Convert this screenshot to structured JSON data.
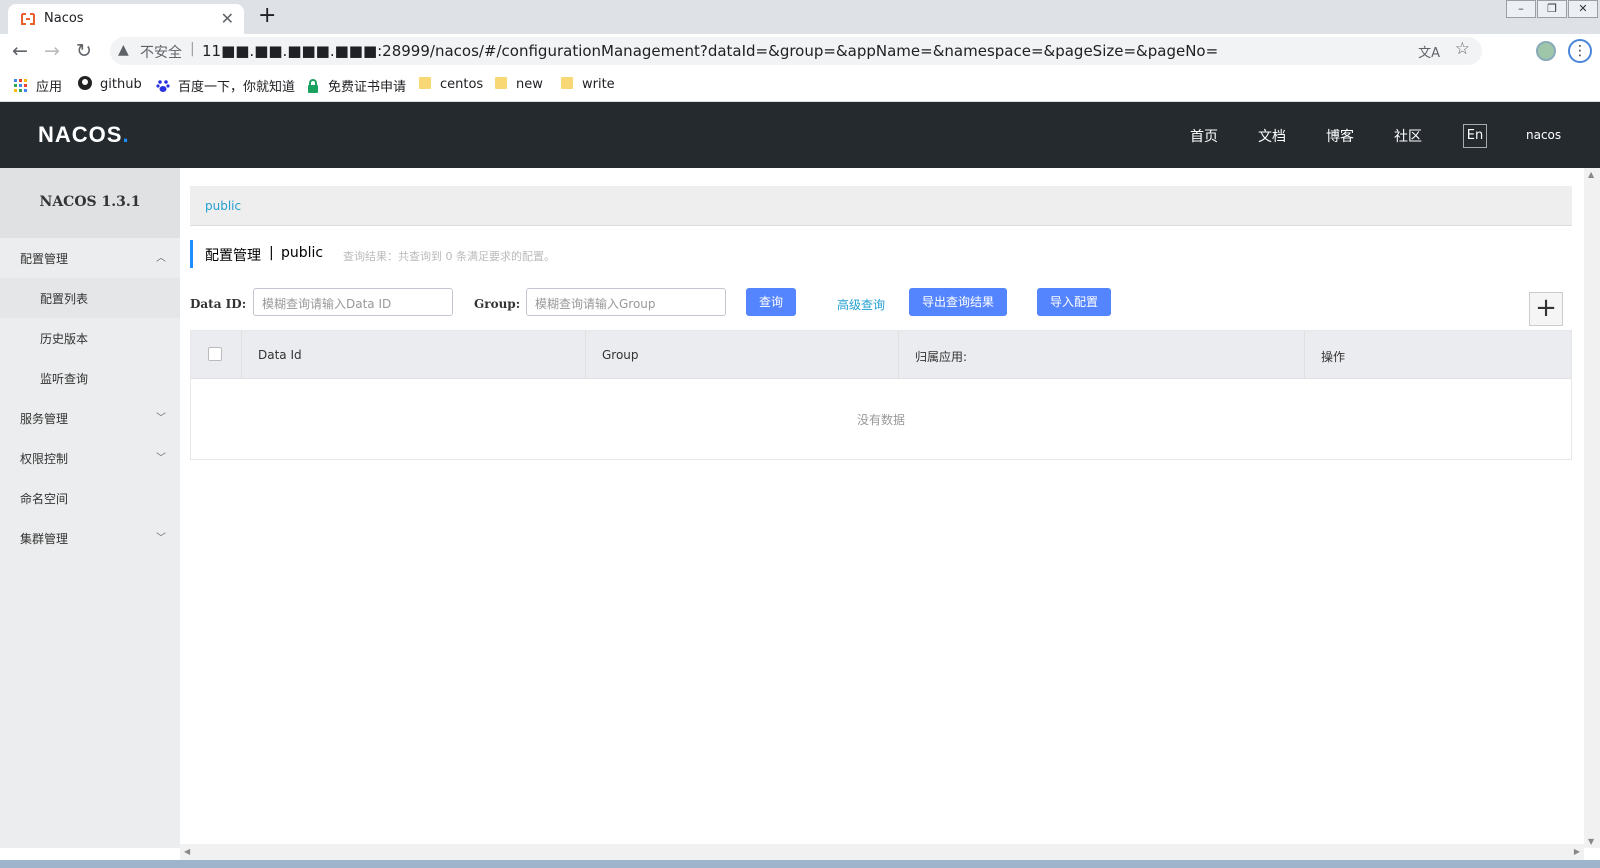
{
  "browser": {
    "tab_title": "Nacos",
    "tab_close": "✕",
    "new_tab": "+",
    "insecure_label": "不安全",
    "url": "11■■.■■.■■■.■■■:28999/nacos/#/configurationManagement?dataId=&group=&appName=&namespace=&pageSize=&pageNo=",
    "bookmarks": [
      {
        "label": "应用",
        "icon": "apps-grid-icon"
      },
      {
        "label": "github",
        "icon": "github-icon"
      },
      {
        "label": "百度一下，你就知道",
        "icon": "baidu-icon"
      },
      {
        "label": "免费证书申请",
        "icon": "lock-icon"
      },
      {
        "label": "centos",
        "icon": "folder-icon"
      },
      {
        "label": "new",
        "icon": "folder-icon"
      },
      {
        "label": "write",
        "icon": "folder-icon"
      }
    ]
  },
  "header": {
    "logo_main": "NACOS",
    "logo_dot": ".",
    "nav": [
      "首页",
      "文档",
      "博客",
      "社区"
    ],
    "lang": "En",
    "user": "nacos"
  },
  "sidebar": {
    "title": "NACOS 1.3.1",
    "items": [
      {
        "label": "配置管理",
        "chevron": "^"
      },
      {
        "label": "配置列表"
      },
      {
        "label": "历史版本"
      },
      {
        "label": "监听查询"
      },
      {
        "label": "服务管理",
        "chevron": "v"
      },
      {
        "label": "权限控制",
        "chevron": "v"
      },
      {
        "label": "命名空间"
      },
      {
        "label": "集群管理",
        "chevron": "v"
      }
    ]
  },
  "main": {
    "namespace_tab": "public",
    "breadcrumb": {
      "title": "配置管理",
      "separator": "|",
      "namespace": "public",
      "result": "查询结果：共查询到 0 条满足要求的配置。"
    },
    "filters": {
      "data_id_label": "Data ID:",
      "data_id_placeholder": "模糊查询请输入Data ID",
      "group_label": "Group:",
      "group_placeholder": "模糊查询请输入Group"
    },
    "buttons": {
      "query": "查询",
      "advanced": "高级查询",
      "export": "导出查询结果",
      "import": "导入配置",
      "add": "+"
    },
    "table": {
      "columns": [
        "Data Id",
        "Group",
        "归属应用:",
        "操作"
      ],
      "empty": "没有数据"
    }
  },
  "colors": {
    "header_bg": "#252a2f",
    "primary": "#5584ff",
    "link": "#23a0d2",
    "accent": "#1e8efc"
  }
}
